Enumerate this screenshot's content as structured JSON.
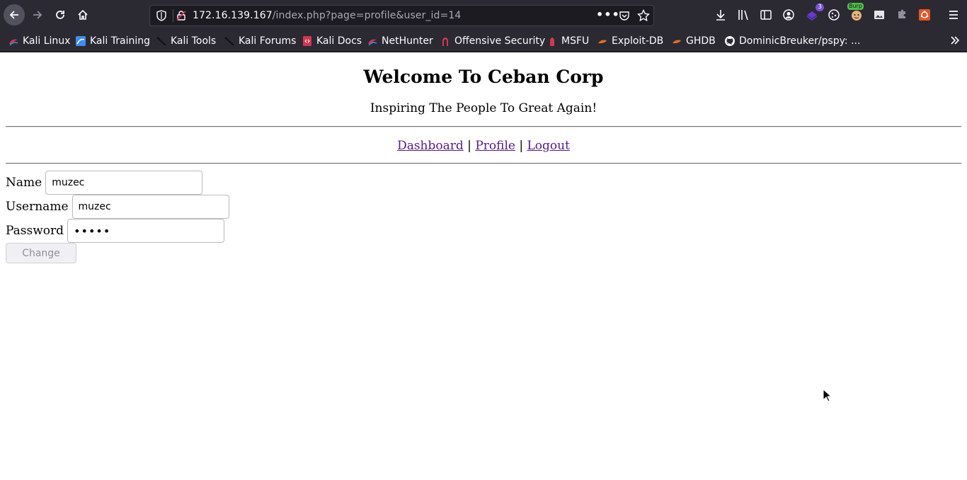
{
  "browser": {
    "url_host": "172.16.139.167",
    "url_path": "/index.php?page=profile&user_id=14",
    "extensions": [
      {
        "name": "extension-badge-3",
        "badge": "3"
      },
      {
        "name": "burp-extension",
        "badge": "Burp"
      }
    ]
  },
  "bookmarks": [
    {
      "label": "Kali Linux",
      "icon": "kali-dragon-icon"
    },
    {
      "label": "Kali Training",
      "icon": "kali-training-icon"
    },
    {
      "label": "Kali Tools",
      "icon": "kali-tools-icon"
    },
    {
      "label": "Kali Forums",
      "icon": "kali-forums-icon"
    },
    {
      "label": "Kali Docs",
      "icon": "kali-docs-icon"
    },
    {
      "label": "NetHunter",
      "icon": "nethunter-icon"
    },
    {
      "label": "Offensive Security",
      "icon": "offsec-icon"
    },
    {
      "label": "MSFU",
      "icon": "msfu-icon"
    },
    {
      "label": "Exploit-DB",
      "icon": "exploitdb-icon"
    },
    {
      "label": "GHDB",
      "icon": "ghdb-icon"
    },
    {
      "label": "DominicBreuker/pspy: ...",
      "icon": "github-icon"
    }
  ],
  "page": {
    "title": "Welcome To Ceban Corp",
    "subtitle": "Inspiring The People To Great Again!",
    "nav": {
      "dashboard": "Dashboard",
      "profile": "Profile",
      "logout": "Logout",
      "separator": "|"
    },
    "form": {
      "name_label": "Name",
      "name_value": "muzec",
      "username_label": "Username",
      "username_value": "muzec",
      "password_label": "Password",
      "password_value": "muzec",
      "change_label": "Change"
    }
  },
  "colors": {
    "chrome_bg": "#2b2a33",
    "urlbar_bg": "#1c1b22",
    "link_visited": "#551a8b"
  }
}
